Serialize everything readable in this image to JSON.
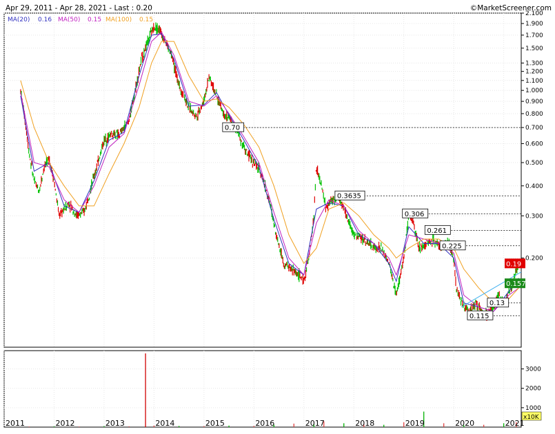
{
  "header": {
    "range_text": "Apr 29, 2011 - Apr 28, 2021 - Last : 0.20",
    "copyright": "©MarketScreener.com"
  },
  "legend": [
    {
      "label": "MA(20)",
      "value": "0.16",
      "color": "#3030c0"
    },
    {
      "label": "MA(50)",
      "value": "0.15",
      "color": "#c020c0"
    },
    {
      "label": "MA(100)",
      "value": "0.15",
      "color": "#f0a020"
    }
  ],
  "chart_data": [
    {
      "type": "line",
      "subtype": "candlestick-with-moving-averages",
      "scale": "log",
      "ylim": [
        0.085,
        2.1
      ],
      "xlim": [
        2011.0,
        2021.35
      ],
      "x_ticks": [
        "2011",
        "2012",
        "2013",
        "2014",
        "2015",
        "2016",
        "2017",
        "2018",
        "2019",
        "2020",
        "2021"
      ],
      "y_ticks": [
        "2.100",
        "1.900",
        "1.700",
        "1.500",
        "1.300",
        "1.200",
        "1.100",
        "1.000",
        "0.900",
        "0.800",
        "0.700",
        "0.600",
        "0.500",
        "0.400",
        "0.300",
        "0.200"
      ],
      "grid": true,
      "price": {
        "x": [
          2011.33,
          2011.4,
          2011.5,
          2011.6,
          2011.7,
          2011.8,
          2011.9,
          2012.0,
          2012.1,
          2012.2,
          2012.3,
          2012.45,
          2012.6,
          2012.8,
          2013.0,
          2013.15,
          2013.3,
          2013.5,
          2013.6,
          2013.75,
          2013.9,
          2014.0,
          2014.1,
          2014.2,
          2014.35,
          2014.5,
          2014.7,
          2014.85,
          2015.0,
          2015.1,
          2015.25,
          2015.4,
          2015.55,
          2015.7,
          2015.85,
          2016.0,
          2016.15,
          2016.3,
          2016.45,
          2016.6,
          2016.75,
          2016.9,
          2017.0,
          2017.1,
          2017.2,
          2017.25,
          2017.35,
          2017.45,
          2017.55,
          2017.7,
          2017.85,
          2018.0,
          2018.2,
          2018.4,
          2018.55,
          2018.7,
          2018.85,
          2019.0,
          2019.1,
          2019.2,
          2019.3,
          2019.45,
          2019.6,
          2019.75,
          2019.9,
          2020.0,
          2020.05,
          2020.15,
          2020.3,
          2020.45,
          2020.6,
          2020.75,
          2020.9,
          2021.0,
          2021.1,
          2021.2,
          2021.3
        ],
        "y": [
          1.0,
          0.8,
          0.55,
          0.42,
          0.38,
          0.48,
          0.52,
          0.42,
          0.3,
          0.32,
          0.34,
          0.3,
          0.31,
          0.44,
          0.62,
          0.66,
          0.65,
          0.75,
          0.95,
          1.35,
          1.65,
          1.85,
          1.8,
          1.65,
          1.4,
          1.05,
          0.85,
          0.78,
          0.9,
          1.15,
          0.95,
          0.8,
          0.75,
          0.65,
          0.55,
          0.5,
          0.45,
          0.35,
          0.25,
          0.19,
          0.18,
          0.17,
          0.16,
          0.2,
          0.3,
          0.48,
          0.4,
          0.32,
          0.35,
          0.36,
          0.3,
          0.25,
          0.24,
          0.22,
          0.22,
          0.19,
          0.14,
          0.2,
          0.3,
          0.28,
          0.22,
          0.23,
          0.24,
          0.22,
          0.23,
          0.2,
          0.15,
          0.13,
          0.12,
          0.13,
          0.115,
          0.12,
          0.14,
          0.13,
          0.145,
          0.16,
          0.19
        ]
      },
      "moving_averages": [
        {
          "name": "MA(20)",
          "color": "#3030c0",
          "x": [
            2011.33,
            2011.6,
            2011.9,
            2012.2,
            2012.5,
            2012.8,
            2013.1,
            2013.4,
            2013.7,
            2013.95,
            2014.15,
            2014.4,
            2014.7,
            2015.0,
            2015.25,
            2015.5,
            2015.8,
            2016.1,
            2016.4,
            2016.7,
            2017.0,
            2017.25,
            2017.5,
            2017.8,
            2018.1,
            2018.4,
            2018.7,
            2018.85,
            2019.1,
            2019.4,
            2019.7,
            2020.0,
            2020.2,
            2020.5,
            2020.8,
            2021.1,
            2021.3
          ],
          "y": [
            0.95,
            0.46,
            0.5,
            0.33,
            0.31,
            0.42,
            0.62,
            0.67,
            1.15,
            1.7,
            1.72,
            1.35,
            0.86,
            0.87,
            0.98,
            0.79,
            0.62,
            0.48,
            0.29,
            0.19,
            0.17,
            0.32,
            0.34,
            0.33,
            0.25,
            0.23,
            0.19,
            0.16,
            0.27,
            0.23,
            0.23,
            0.2,
            0.13,
            0.125,
            0.12,
            0.145,
            0.165
          ]
        },
        {
          "name": "MA(50)",
          "color": "#c020c0",
          "x": [
            2011.33,
            2011.6,
            2011.9,
            2012.2,
            2012.5,
            2012.8,
            2013.1,
            2013.4,
            2013.7,
            2013.95,
            2014.15,
            2014.4,
            2014.7,
            2015.0,
            2015.25,
            2015.5,
            2015.8,
            2016.1,
            2016.4,
            2016.7,
            2017.0,
            2017.25,
            2017.5,
            2017.8,
            2018.1,
            2018.4,
            2018.7,
            2018.85,
            2019.1,
            2019.4,
            2019.7,
            2020.0,
            2020.2,
            2020.5,
            2020.8,
            2021.1,
            2021.3
          ],
          "y": [
            0.98,
            0.5,
            0.48,
            0.35,
            0.31,
            0.4,
            0.58,
            0.66,
            1.05,
            1.6,
            1.75,
            1.4,
            0.9,
            0.86,
            0.95,
            0.8,
            0.64,
            0.5,
            0.31,
            0.2,
            0.17,
            0.28,
            0.35,
            0.33,
            0.26,
            0.23,
            0.2,
            0.17,
            0.25,
            0.24,
            0.23,
            0.21,
            0.14,
            0.125,
            0.12,
            0.14,
            0.15
          ]
        },
        {
          "name": "MA(100)",
          "color": "#f0a020",
          "x": [
            2011.33,
            2011.6,
            2011.9,
            2012.2,
            2012.5,
            2012.8,
            2013.1,
            2013.4,
            2013.7,
            2013.95,
            2014.15,
            2014.4,
            2014.7,
            2015.0,
            2015.25,
            2015.5,
            2015.8,
            2016.1,
            2016.4,
            2016.7,
            2017.0,
            2017.25,
            2017.5,
            2017.8,
            2018.1,
            2018.4,
            2018.7,
            2018.85,
            2019.1,
            2019.4,
            2019.7,
            2020.0,
            2020.2,
            2020.5,
            2020.8,
            2021.1,
            2021.3
          ],
          "y": [
            1.1,
            0.7,
            0.5,
            0.4,
            0.33,
            0.33,
            0.45,
            0.6,
            0.85,
            1.3,
            1.6,
            1.6,
            1.15,
            0.9,
            0.92,
            0.85,
            0.72,
            0.58,
            0.4,
            0.25,
            0.19,
            0.22,
            0.32,
            0.34,
            0.3,
            0.25,
            0.22,
            0.2,
            0.22,
            0.24,
            0.24,
            0.22,
            0.18,
            0.15,
            0.13,
            0.135,
            0.15
          ]
        }
      ],
      "trendline": {
        "color": "#40b0f0",
        "x": [
          2020.15,
          2021.35
        ],
        "y": [
          0.125,
          0.175
        ]
      },
      "levels": [
        {
          "label": "0.70",
          "value": 0.7,
          "x_start": 2015.4
        },
        {
          "label": "0.3635",
          "value": 0.3635,
          "x_start": 2017.65
        },
        {
          "label": "0.306",
          "value": 0.306,
          "x_start": 2019.0
        },
        {
          "label": "0.261",
          "value": 0.261,
          "x_start": 2019.45
        },
        {
          "label": "0.225",
          "value": 0.225,
          "x_start": 2019.75
        },
        {
          "label": "0.13",
          "value": 0.13,
          "x_start": 2020.7
        },
        {
          "label": "0.115",
          "value": 0.115,
          "x_start": 2020.3
        }
      ],
      "last_badges": [
        {
          "label": "0.19",
          "value": 0.19,
          "color": "#e00000"
        },
        {
          "label": "0.157",
          "value": 0.157,
          "color": "#1a8a1a"
        }
      ]
    },
    {
      "type": "bar",
      "name": "volume",
      "ylim": [
        0,
        3800
      ],
      "y_ticks": [
        "3000",
        "2000",
        "1000"
      ],
      "unit_label": "x10K",
      "x": [
        2011.5,
        2012.0,
        2012.5,
        2013.0,
        2013.5,
        2013.83,
        2014.0,
        2014.5,
        2015.0,
        2015.5,
        2016.0,
        2016.4,
        2016.8,
        2017.2,
        2017.4,
        2017.8,
        2018.2,
        2018.6,
        2019.0,
        2019.4,
        2019.8,
        2020.2,
        2020.6,
        2021.0,
        2021.25
      ],
      "values": [
        30,
        40,
        30,
        50,
        40,
        3800,
        80,
        60,
        50,
        80,
        60,
        120,
        180,
        150,
        300,
        200,
        150,
        120,
        250,
        800,
        200,
        100,
        120,
        200,
        250
      ]
    }
  ]
}
